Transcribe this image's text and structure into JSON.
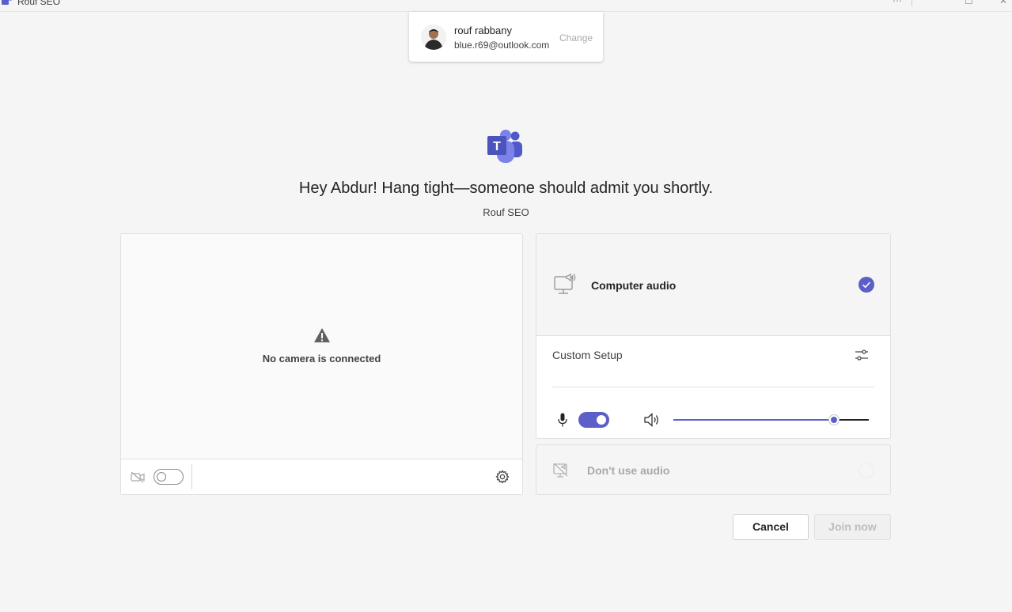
{
  "window": {
    "title": "Rouf SEO",
    "app_icon": "teams-icon"
  },
  "account": {
    "name": "rouf rabbany",
    "email": "blue.r69@outlook.com",
    "change_label": "Change"
  },
  "headline": "Hey Abdur! Hang tight—someone should admit you shortly.",
  "meeting_name": "Rouf SEO",
  "video": {
    "message": "No camera is connected",
    "camera_enabled": false
  },
  "audio": {
    "computer_audio_label": "Computer audio",
    "computer_audio_selected": true,
    "custom_setup_label": "Custom Setup",
    "mic_enabled": true,
    "speaker_volume": 0.82,
    "no_audio_label": "Don't use audio",
    "no_audio_selected": false
  },
  "buttons": {
    "cancel": "Cancel",
    "join": "Join now"
  },
  "colors": {
    "accent": "#5b5fc7",
    "background": "#f5f5f5"
  }
}
